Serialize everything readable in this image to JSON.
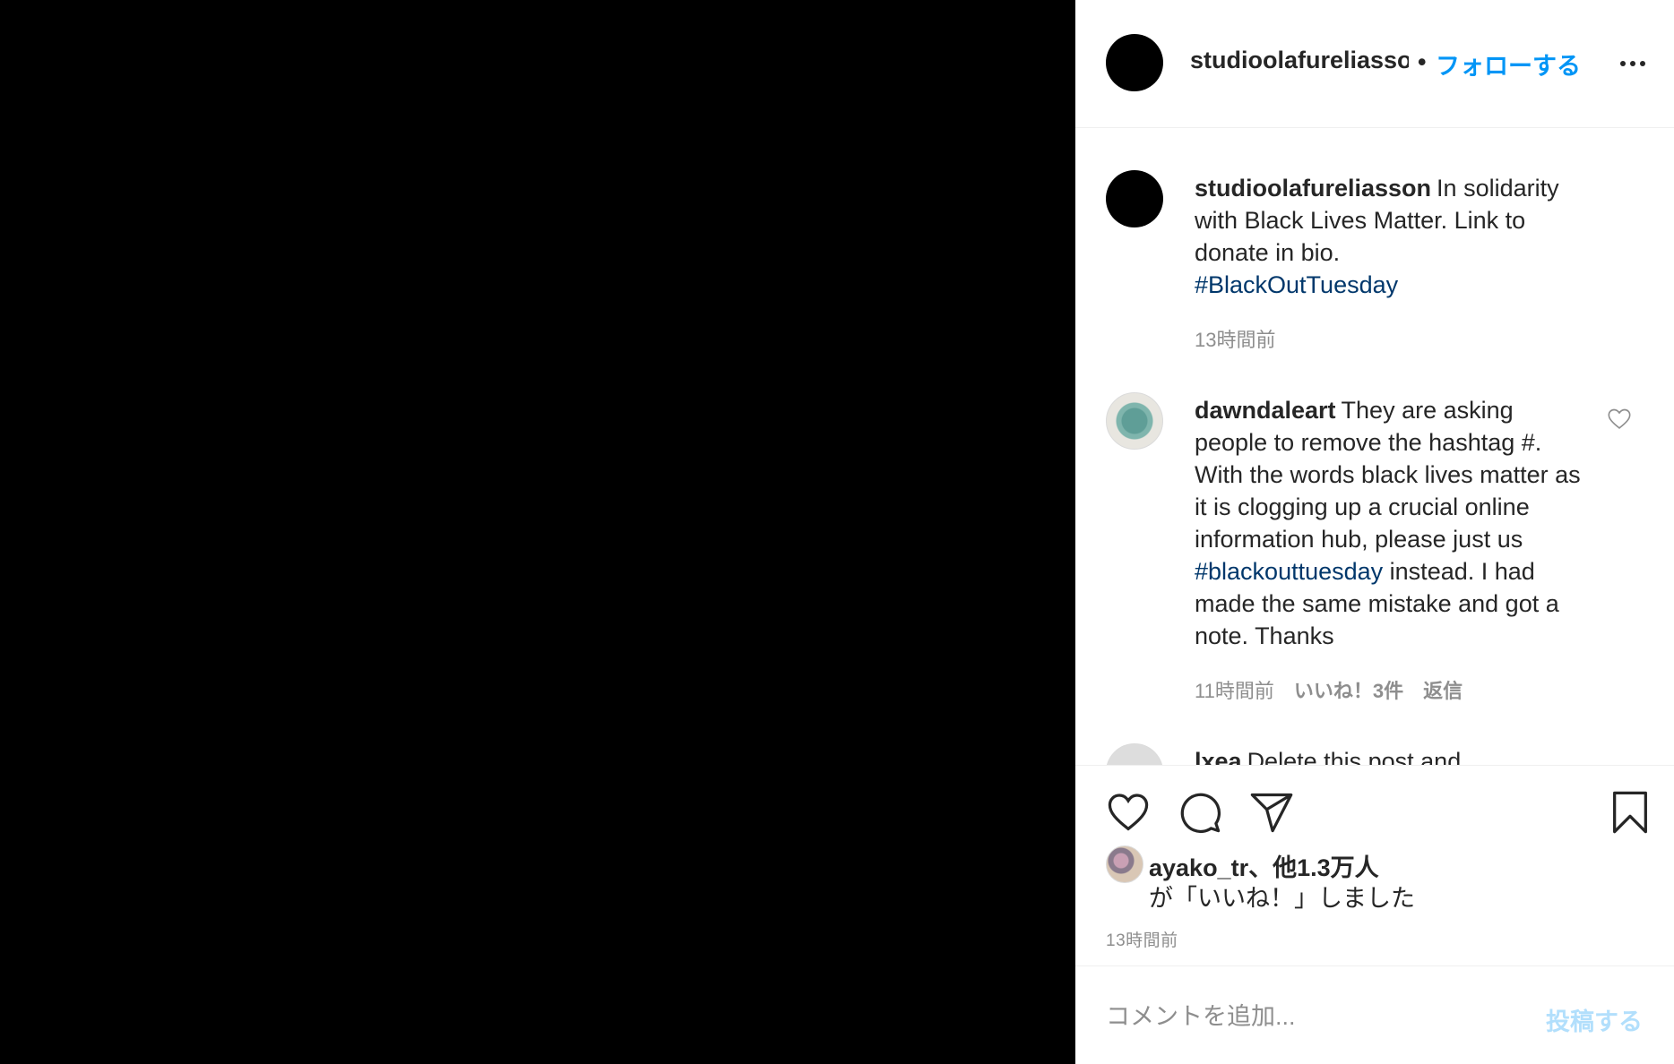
{
  "header": {
    "username": "studioolafureliasson",
    "separator": "•",
    "follow_label": "フォローする",
    "more_icon": "more-horizontal-icon"
  },
  "caption": {
    "username": "studioolafureliasson",
    "text": "In solidarity with Black Lives Matter. Link to donate in bio.",
    "hashtag": "#BlackOutTuesday",
    "time": "13時間前"
  },
  "comments": [
    {
      "username": "dawndaleart",
      "text_before": "They are asking people to remove the hashtag #. With the words black lives matter as it is clogging up a crucial online information hub, please just us",
      "hashtag": "#blackouttuesday",
      "text_after": "instead. I had made the same mistake and got a note. Thanks",
      "time": "11時間前",
      "likes": "いいね！3件",
      "reply": "返信"
    },
    {
      "username": "lxea",
      "text_before": "Delete this post and"
    }
  ],
  "actions": {
    "like_icon": "heart-icon",
    "comment_icon": "comment-icon",
    "share_icon": "paper-plane-icon",
    "save_icon": "bookmark-icon"
  },
  "likes": {
    "line1": "ayako_tr、他1.3万人",
    "line2": "が「いいね！」しました"
  },
  "post_time": "13時間前",
  "add_comment": {
    "placeholder": "コメントを追加...",
    "post_label": "投稿する"
  }
}
